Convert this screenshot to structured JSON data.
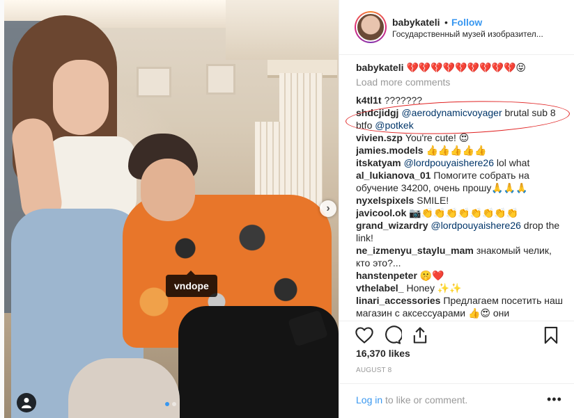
{
  "post": {
    "tag_label": "vndope",
    "carousel": {
      "count": 2,
      "active": 0
    },
    "next_arrow": "›"
  },
  "header": {
    "username": "babykateli",
    "separator": "•",
    "follow_label": "Follow",
    "location": "Государственный музей изобразител..."
  },
  "caption": {
    "user": "babykateli",
    "text": "💔💔💔💔💔💔💔💔💔😝"
  },
  "load_more": "Load more comments",
  "comments": [
    {
      "user": "k4tl1t",
      "parts": [
        {
          "t": "???????"
        }
      ]
    },
    {
      "user": "shdcjidgj",
      "parts": [
        {
          "t": "@aerodynamicvoyager",
          "m": true
        },
        {
          "t": " brutal sub 8 btfo "
        },
        {
          "t": "@potkek",
          "m": true
        }
      ]
    },
    {
      "user": "vivien.szp",
      "parts": [
        {
          "t": "You're cute! 😍"
        }
      ]
    },
    {
      "user": "jamies.models",
      "parts": [
        {
          "t": "👍👍👍👍👍"
        }
      ]
    },
    {
      "user": "itskatyam",
      "parts": [
        {
          "t": "@lordpouyaishere26",
          "m": true
        },
        {
          "t": " lol what"
        }
      ]
    },
    {
      "user": "al_lukianova_01",
      "parts": [
        {
          "t": "Помогите собрать на обучение 34200, очень прошу🙏🙏🙏"
        }
      ]
    },
    {
      "user": "nyxelspixels",
      "parts": [
        {
          "t": "SMILE!"
        }
      ]
    },
    {
      "user": "javicool.ok",
      "parts": [
        {
          "t": "📷👏👏👏👏👏👏👏👏"
        }
      ]
    },
    {
      "user": "grand_wizardry",
      "parts": [
        {
          "t": "@lordpouyaishere26",
          "m": true
        },
        {
          "t": " drop the link!"
        }
      ]
    },
    {
      "user": "ne_izmenyu_staylu_mam",
      "parts": [
        {
          "t": "знакомый челик, кто это?..."
        }
      ]
    },
    {
      "user": "hanstenpeter",
      "parts": [
        {
          "t": "🤫❤️"
        }
      ]
    },
    {
      "user": "vthelabel_",
      "parts": [
        {
          "t": "Honey ✨✨"
        }
      ]
    },
    {
      "user": "linari_accessories",
      "parts": [
        {
          "t": "Предлагаем посетить наш магазин с аксессуарами 👍😍 они"
        }
      ]
    }
  ],
  "likes": "16,370 likes",
  "date": "AUGUST 8",
  "login": {
    "link": "Log in",
    "rest": " to like or comment."
  },
  "more_label": "•••",
  "icons": [
    "heart-icon",
    "comment-icon",
    "share-icon",
    "bookmark-icon",
    "user-tag-icon",
    "chevron-right-icon",
    "more-options-icon"
  ],
  "colors": {
    "accent": "#3897f0",
    "mention": "#003569",
    "muted": "#999999",
    "annotation": "#e02020"
  }
}
